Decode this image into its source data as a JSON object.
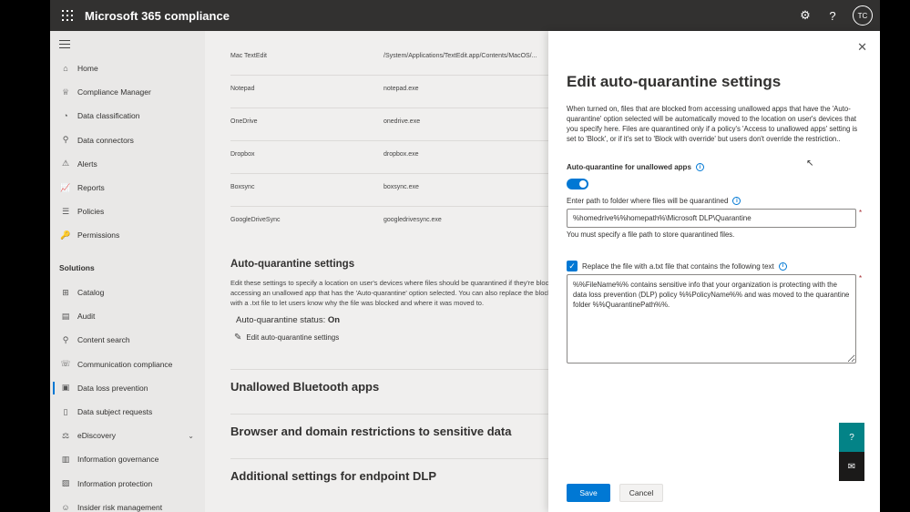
{
  "topbar": {
    "app_title": "Microsoft 365 compliance",
    "settings_icon": "gear-icon",
    "help_label": "?",
    "avatar_initials": "TC"
  },
  "nav": {
    "items": [
      {
        "label": "Home",
        "icon": "⌂"
      },
      {
        "label": "Compliance Manager",
        "icon": "♕"
      },
      {
        "label": "Data classification",
        "icon": "◔"
      },
      {
        "label": "Data connectors",
        "icon": "⚲"
      },
      {
        "label": "Alerts",
        "icon": "⚠"
      },
      {
        "label": "Reports",
        "icon": "📈"
      },
      {
        "label": "Policies",
        "icon": "☰"
      },
      {
        "label": "Permissions",
        "icon": "🔑"
      }
    ],
    "section_label": "Solutions",
    "solutions": [
      {
        "label": "Catalog",
        "icon": "⊞"
      },
      {
        "label": "Audit",
        "icon": "▤"
      },
      {
        "label": "Content search",
        "icon": "⚲"
      },
      {
        "label": "Communication compliance",
        "icon": "☏"
      },
      {
        "label": "Data loss prevention",
        "icon": "▣"
      },
      {
        "label": "Data subject requests",
        "icon": "▯"
      },
      {
        "label": "eDiscovery",
        "icon": "⚖",
        "chevron": "⌄"
      },
      {
        "label": "Information governance",
        "icon": "▥"
      },
      {
        "label": "Information protection",
        "icon": "▨"
      },
      {
        "label": "Insider risk management",
        "icon": "☺"
      }
    ]
  },
  "main": {
    "apps": [
      {
        "name": "Mac TextEdit",
        "path": "/System/Applications/TextEdit.app/Contents/MacOS/..."
      },
      {
        "name": "Notepad",
        "path": "notepad.exe"
      },
      {
        "name": "OneDrive",
        "path": "onedrive.exe"
      },
      {
        "name": "Dropbox",
        "path": "dropbox.exe"
      },
      {
        "name": "Boxsync",
        "path": "boxsync.exe"
      },
      {
        "name": "GoogleDriveSync",
        "path": "googledrivesync.exe"
      }
    ],
    "aq_title": "Auto-quarantine settings",
    "aq_desc": "Edit these settings to specify a location on user's devices where files should be quarantined if they're blocked from accessing an unallowed app that has the 'Auto-quarantine' option selected. You can also replace the blocked file with a .txt file to let users know why the file was blocked and where it was moved to.",
    "aq_status_label": "Auto-quarantine status:",
    "aq_status_value": "On",
    "aq_edit_label": "Edit auto-quarantine settings",
    "sections": [
      "Unallowed Bluetooth apps",
      "Browser and domain restrictions to sensitive data",
      "Additional settings for endpoint DLP"
    ]
  },
  "panel": {
    "title": "Edit auto-quarantine settings",
    "description": "When turned on, files that are blocked from accessing unallowed apps that have the 'Auto-quarantine' option selected will be automatically moved to the location on user's devices that you specify here. Files are quarantined only if a policy's 'Access to unallowed apps' setting is set to 'Block', or if it's set to 'Block with override' but users don't override the restriction..",
    "toggle_label": "Auto-quarantine for unallowed apps",
    "toggle_on": true,
    "path_label": "Enter path to folder where files will be quarantined",
    "path_value": "%homedrive%%homepath%\\Microsoft DLP\\Quarantine",
    "path_error": "You must specify a file path to store quarantined files.",
    "replace_label": "Replace the file with a.txt file that contains the following text",
    "replace_checked": true,
    "replace_text": "%%FileName%% contains sensitive info that your organization is protecting with the data loss prevention (DLP) policy %%PolicyName%% and was moved to the quarantine folder %%QuarantinePath%%.",
    "save_label": "Save",
    "cancel_label": "Cancel",
    "close_label": "✕",
    "required_mark": "*"
  },
  "colors": {
    "accent": "#0078d4",
    "topbar": "#323130",
    "help_teal": "#038387"
  }
}
